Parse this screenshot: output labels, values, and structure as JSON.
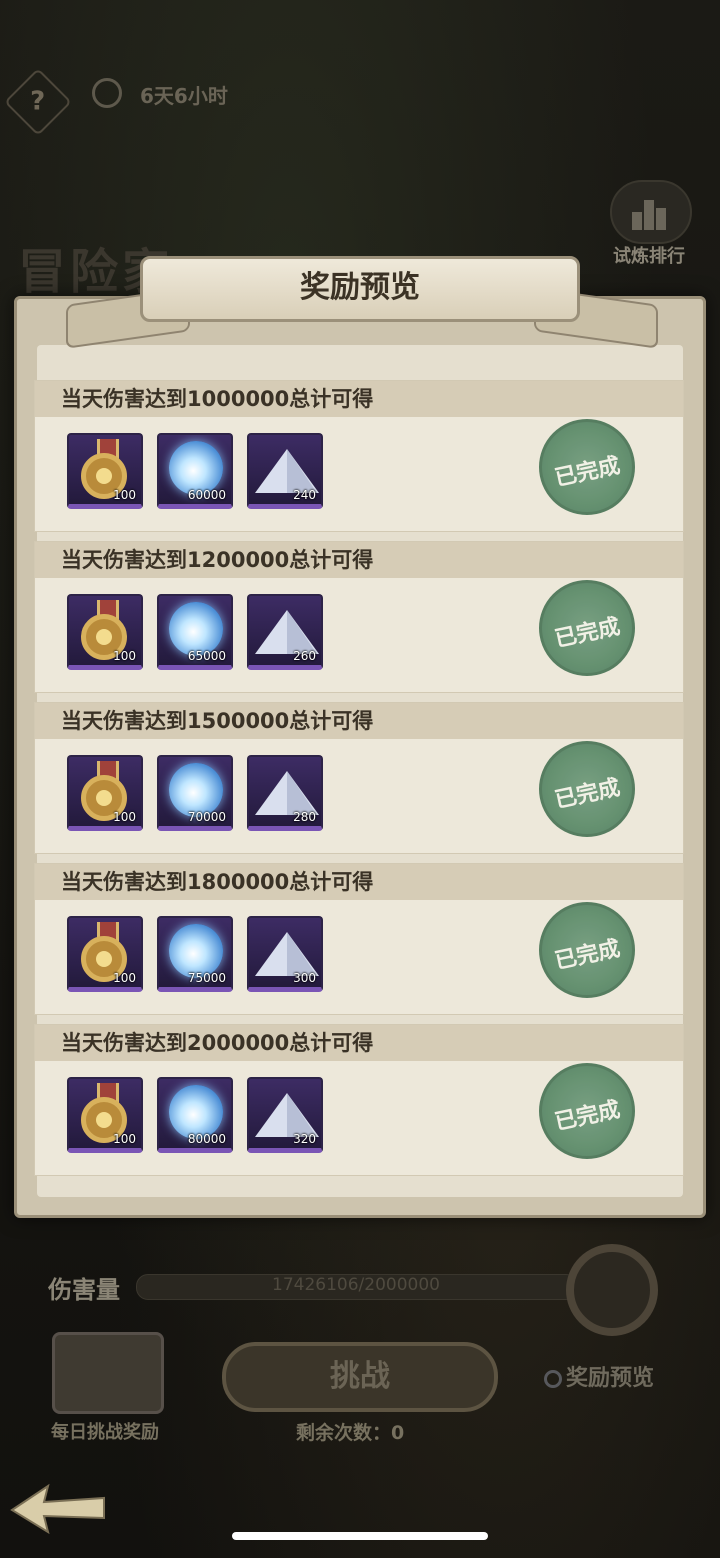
{
  "background": {
    "help_label": "?",
    "time_left": "6天6小时",
    "mode_title": "冒险家",
    "rank_label": "试炼排行"
  },
  "dialog": {
    "title": "奖励预览",
    "rows": [
      {
        "header": "当天伤害达到1000000总计可得",
        "rewards": [
          {
            "icon": "medal-icon",
            "qty": "100"
          },
          {
            "icon": "orb-icon",
            "qty": "60000"
          },
          {
            "icon": "dust-icon",
            "qty": "240"
          }
        ],
        "status": "已完成"
      },
      {
        "header": "当天伤害达到1200000总计可得",
        "rewards": [
          {
            "icon": "medal-icon",
            "qty": "100"
          },
          {
            "icon": "orb-icon",
            "qty": "65000"
          },
          {
            "icon": "dust-icon",
            "qty": "260"
          }
        ],
        "status": "已完成"
      },
      {
        "header": "当天伤害达到1500000总计可得",
        "rewards": [
          {
            "icon": "medal-icon",
            "qty": "100"
          },
          {
            "icon": "orb-icon",
            "qty": "70000"
          },
          {
            "icon": "dust-icon",
            "qty": "280"
          }
        ],
        "status": "已完成"
      },
      {
        "header": "当天伤害达到1800000总计可得",
        "rewards": [
          {
            "icon": "medal-icon",
            "qty": "100"
          },
          {
            "icon": "orb-icon",
            "qty": "75000"
          },
          {
            "icon": "dust-icon",
            "qty": "300"
          }
        ],
        "status": "已完成"
      },
      {
        "header": "当天伤害达到2000000总计可得",
        "rewards": [
          {
            "icon": "medal-icon",
            "qty": "100"
          },
          {
            "icon": "orb-icon",
            "qty": "80000"
          },
          {
            "icon": "dust-icon",
            "qty": "320"
          }
        ],
        "status": "已完成"
      }
    ]
  },
  "bottom": {
    "damage_label": "伤害量",
    "damage_value": "17426106/2000000",
    "daily_reward_label": "每日挑战奖励",
    "challenge_label": "挑战",
    "remaining_label": "剩余次数：0",
    "preview_label": "奖励预览"
  },
  "colors": {
    "panel": "#cdc4ae",
    "row_header": "#d6ccb6",
    "stamp": "#5a8a68",
    "item_bg": "#3d2c64"
  }
}
